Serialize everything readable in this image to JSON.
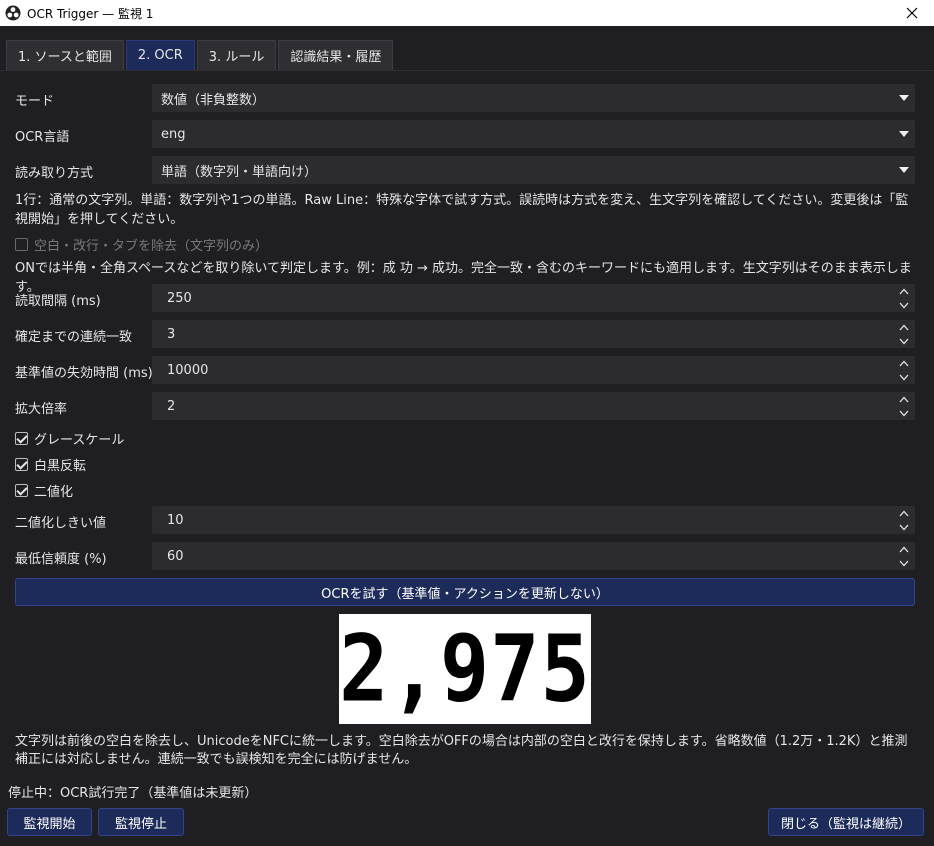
{
  "window": {
    "title": "OCR Trigger — 監視 1",
    "app_icon": "obs-icon",
    "close_icon": "close-icon"
  },
  "tabs": [
    {
      "label": "1. ソースと範囲",
      "active": false
    },
    {
      "label": "2. OCR",
      "active": true
    },
    {
      "label": "3. ルール",
      "active": false
    },
    {
      "label": "認識結果・履歴",
      "active": false
    }
  ],
  "mode": {
    "label": "モード",
    "value": "数値（非負整数）"
  },
  "language": {
    "label": "OCR言語",
    "value": "eng"
  },
  "read_method": {
    "label": "読み取り方式",
    "value": "単語（数字列・単語向け）"
  },
  "read_method_help": "1行：通常の文字列。単語：数字列や1つの単語。Raw Line：特殊な字体で試す方式。誤読時は方式を変え、生文字列を確認してください。変更後は「監視開始」を押してください。",
  "strip_whitespace": {
    "label": "空白・改行・タブを除去（文字列のみ）",
    "checked": false,
    "enabled": false
  },
  "strip_help": "ONでは半角・全角スペースなどを取り除いて判定します。例：成 功 → 成功。完全一致・含むのキーワードにも適用します。生文字列はそのまま表示します。",
  "interval": {
    "label": "読取間隔 (ms)",
    "value": "250"
  },
  "consecutive": {
    "label": "確定までの連続一致",
    "value": "3"
  },
  "expire": {
    "label": "基準値の失効時間 (ms)",
    "value": "10000"
  },
  "scale": {
    "label": "拡大倍率",
    "value": "2"
  },
  "grayscale": {
    "label": "グレースケール",
    "checked": true
  },
  "invert": {
    "label": "白黒反転",
    "checked": true
  },
  "binarize": {
    "label": "二値化",
    "checked": true
  },
  "threshold": {
    "label": "二値化しきい値",
    "value": "10"
  },
  "min_confidence": {
    "label": "最低信頼度 (%)",
    "value": "60"
  },
  "test_button": "OCRを試す（基準値・アクションを更新しない）",
  "preview_value": "2,975",
  "footer_help": "文字列は前後の空白を除去し、UnicodeをNFCに統一します。空白除去がOFFの場合は内部の空白と改行を保持します。省略数値（1.2万・1.2K）と推測補正には対応しません。連続一致でも誤検知を完全には防げません。",
  "status": "停止中：OCR試行完了（基準値は未更新）",
  "buttons": {
    "start": "監視開始",
    "stop": "監視停止",
    "close": "閉じる（監視は継続）"
  },
  "colors": {
    "background": "#1f1f23",
    "field": "#2c2c30",
    "accent": "#1d2b5a"
  }
}
